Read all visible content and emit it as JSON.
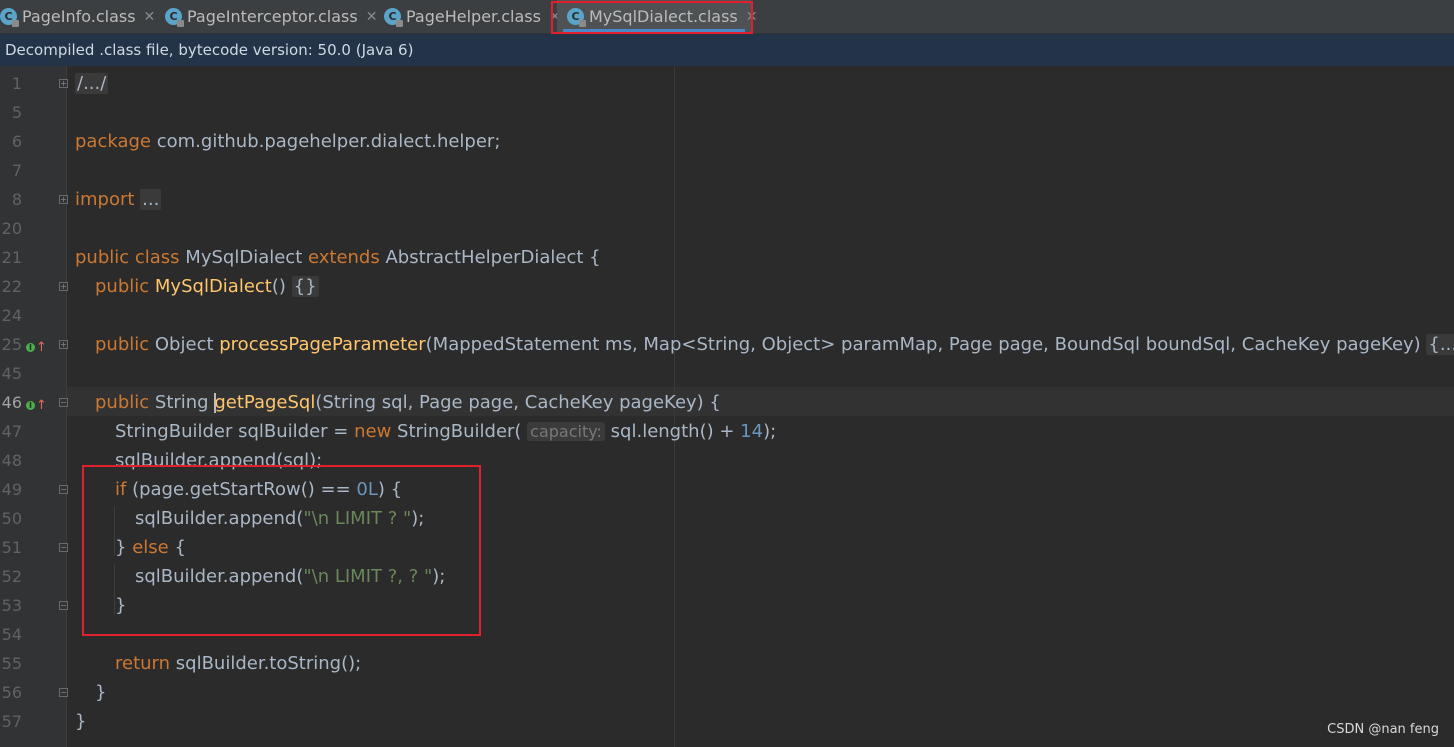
{
  "tabs": [
    {
      "label": "PageInfo.class",
      "icon": "class-file-icon",
      "active": false
    },
    {
      "label": "PageInterceptor.class",
      "icon": "class-file-icon",
      "active": false
    },
    {
      "label": "PageHelper.class",
      "icon": "class-file-icon",
      "active": false
    },
    {
      "label": "MySqlDialect.class",
      "icon": "class-file-icon",
      "active": true
    }
  ],
  "banner": "Decompiled .class file, bytecode version: 50.0 (Java 6)",
  "line_numbers": [
    "1",
    "5",
    "6",
    "7",
    "8",
    "20",
    "21",
    "22",
    "24",
    "25",
    "45",
    "46",
    "47",
    "48",
    "49",
    "50",
    "51",
    "52",
    "53",
    "54",
    "55",
    "56",
    "57"
  ],
  "current_line": "46",
  "code": {
    "l1": "/.../",
    "l6_kw": "package",
    "l6_rest": " com.github.pagehelper.dialect.helper;",
    "l8_kw": "import",
    "l8_fold": "...",
    "l21_kw": "public class",
    "l21_name": " MySqlDialect ",
    "l21_ext": "extends",
    "l21_rest": " AbstractHelperDialect {",
    "l22_kw": "public",
    "l22_fn": "MySqlDialect",
    "l22_rest": "() ",
    "l22_fold": "{}",
    "l25_kw": "public",
    "l25_type": " Object ",
    "l25_fn": "processPageParameter",
    "l25_rest": "(MappedStatement ms, Map<String, Object> paramMap, Page page, BoundSql boundSql, CacheKey pageKey) ",
    "l25_fold": "{...}",
    "l46_kw": "public",
    "l46_type": " String ",
    "l46_fn": "getPageSql",
    "l46_rest": "(String sql, Page page, CacheKey pageKey) {",
    "l47_a": "StringBuilder sqlBuilder = ",
    "l47_kw": "new",
    "l47_b": " StringBuilder(",
    "l47_hint": "capacity:",
    "l47_c": " sql.length() + ",
    "l47_num": "14",
    "l47_d": ");",
    "l48": "sqlBuilder.append(sql);",
    "l49_kw": "if",
    "l49_a": " (page.getStartRow() == ",
    "l49_num": "0L",
    "l49_b": ") {",
    "l50_a": "sqlBuilder.append(",
    "l50_str": "\"\\n LIMIT ? \"",
    "l50_b": ");",
    "l51_a": "} ",
    "l51_kw": "else",
    "l51_b": " {",
    "l52_a": "sqlBuilder.append(",
    "l52_str": "\"\\n LIMIT ?, ? \"",
    "l52_b": ");",
    "l53": "}",
    "l55_kw": "return",
    "l55_rest": " sqlBuilder.toString();",
    "l56": "}",
    "l57": "}"
  },
  "colors": {
    "keyword": "#cc7832",
    "function": "#ffc66d",
    "number": "#6897bb",
    "string": "#6a8759",
    "default": "#a9b7c6",
    "highlight_box": "#e0202c"
  },
  "watermark": "CSDN @nan feng"
}
